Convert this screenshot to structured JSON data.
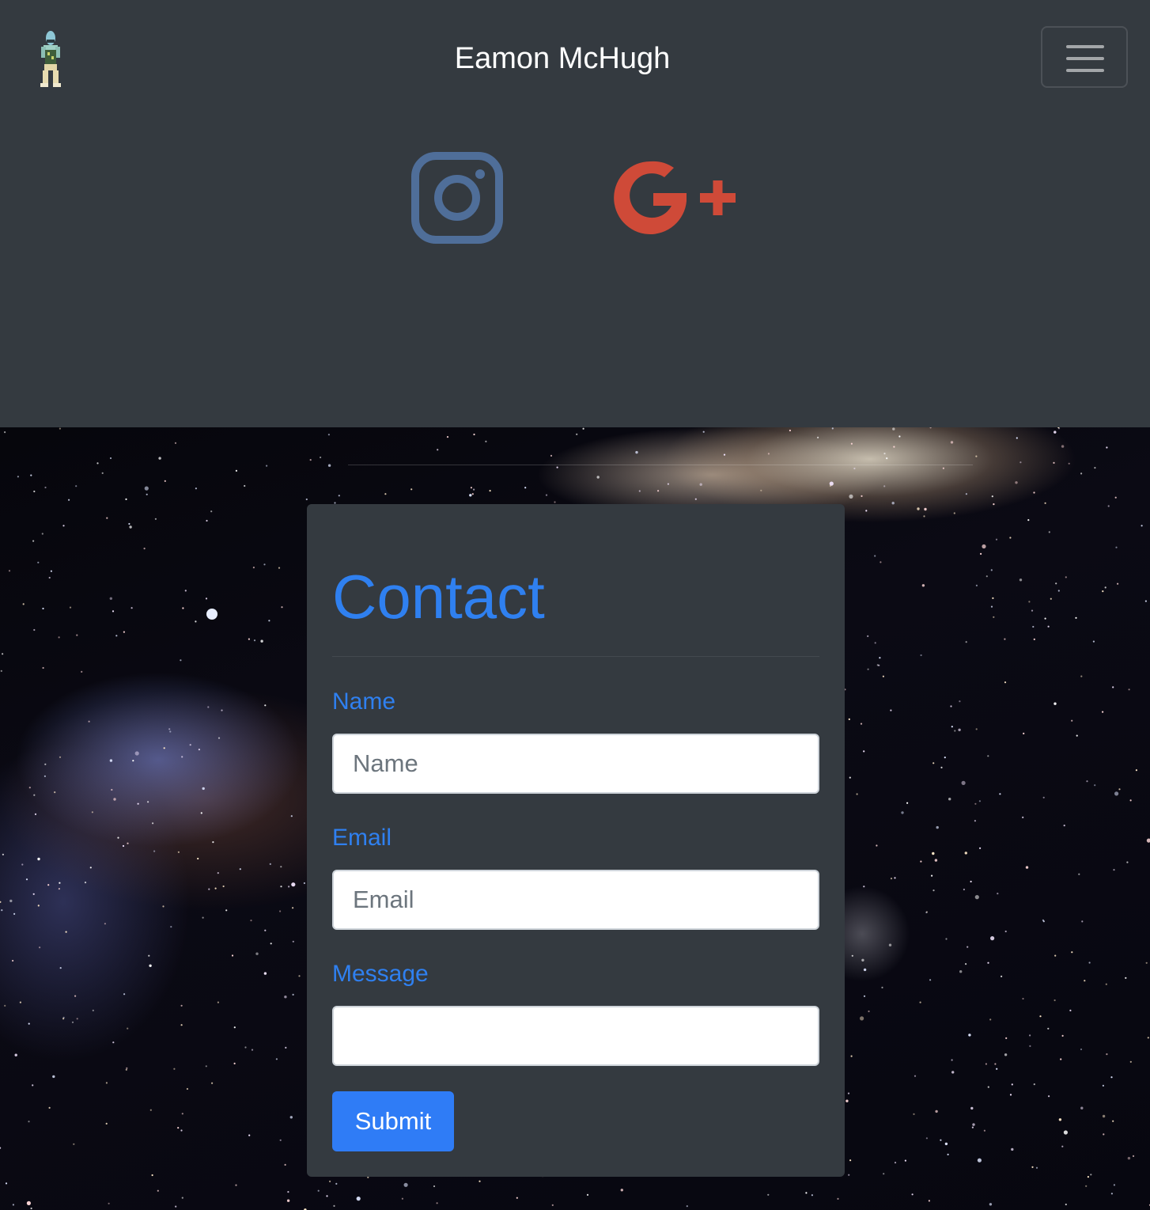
{
  "header": {
    "brand_title": "Eamon McHugh",
    "logo_icon": "character-logo-icon",
    "menu_icon": "hamburger-menu-icon"
  },
  "social": [
    {
      "name": "Instagram",
      "icon": "instagram-icon",
      "color": "#4f6e99"
    },
    {
      "name": "Google+",
      "icon": "google-plus-icon",
      "color": "#cf4a38"
    }
  ],
  "contact": {
    "title": "Contact",
    "fields": {
      "name": {
        "label": "Name",
        "placeholder": "Name",
        "value": ""
      },
      "email": {
        "label": "Email",
        "placeholder": "Email",
        "value": ""
      },
      "message": {
        "label": "Message",
        "placeholder": "",
        "value": ""
      }
    },
    "submit_label": "Submit"
  },
  "colors": {
    "panel_bg": "#343a40",
    "accent": "#2f80f0",
    "button": "#2f7cf6"
  }
}
